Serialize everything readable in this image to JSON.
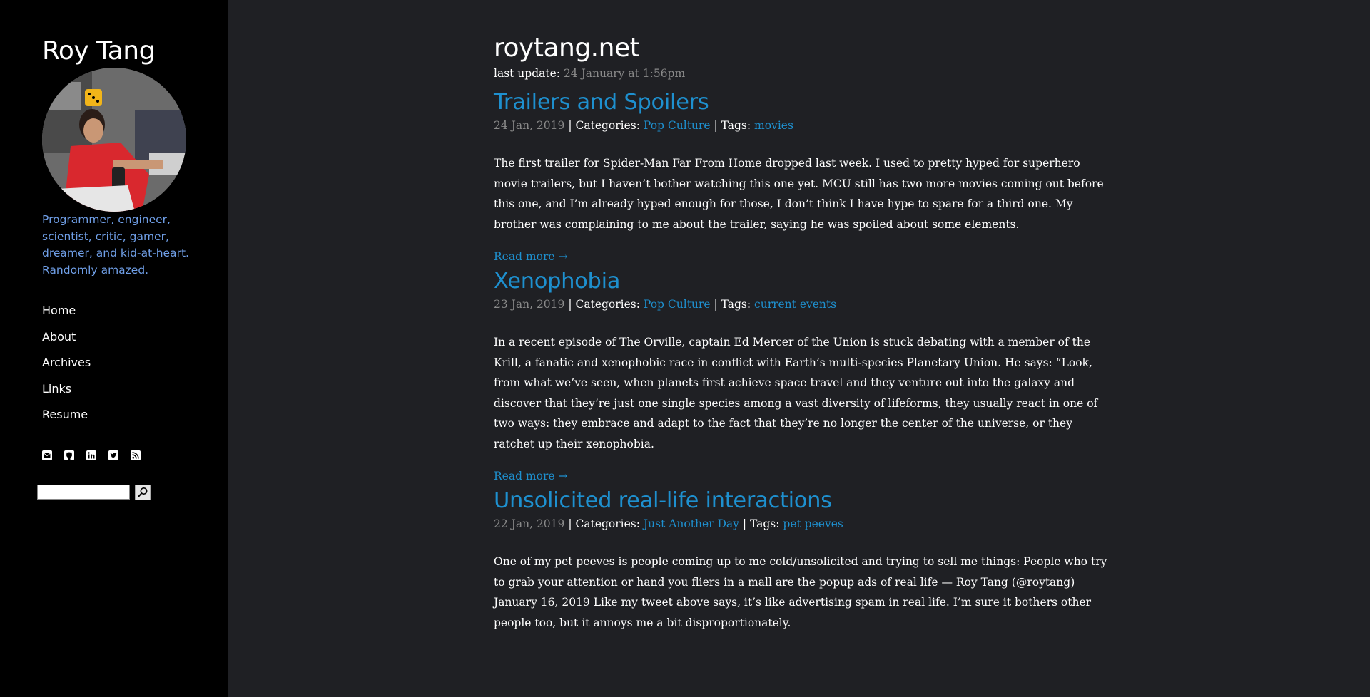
{
  "sidebar": {
    "site_title": "Roy Tang",
    "tagline": "Programmer, engineer, scientist, critic, gamer, dreamer, and kid-at-heart. Randomly amazed.",
    "nav": [
      {
        "label": "Home"
      },
      {
        "label": "About"
      },
      {
        "label": "Archives"
      },
      {
        "label": "Links"
      },
      {
        "label": "Resume"
      }
    ],
    "social_icons": [
      "email-icon",
      "github-icon",
      "linkedin-icon",
      "twitter-icon",
      "rss-icon"
    ],
    "search": {
      "placeholder": "",
      "value": "",
      "button_icon": "search-icon"
    }
  },
  "main": {
    "title": "roytang.net",
    "last_update_label": "last update:",
    "last_update_value": "24 January at 1:56pm",
    "posts": [
      {
        "title": "Trailers and Spoilers",
        "date": "24 Jan, 2019",
        "categories_label": "Categories:",
        "category": "Pop Culture",
        "tags_label": "Tags:",
        "tag": "movies",
        "excerpt": "The first trailer for Spider-Man Far From Home dropped last week. I used to pretty hyped for superhero movie trailers, but I haven’t bother watching this one yet. MCU still has two more movies coming out before this one, and I’m already hyped enough for those, I don’t think I have hype to spare for a third one. My brother was complaining to me about the trailer, saying he was spoiled about some elements.",
        "read_more": "Read more →"
      },
      {
        "title": "Xenophobia",
        "date": "23 Jan, 2019",
        "categories_label": "Categories:",
        "category": "Pop Culture",
        "tags_label": "Tags:",
        "tag": "current events",
        "excerpt": "In a recent episode of The Orville, captain Ed Mercer of the Union is stuck debating with a member of the Krill, a fanatic and xenophobic race in conflict with Earth’s multi-species Planetary Union. He says: “Look, from what we’ve seen, when planets first achieve space travel and they venture out into the galaxy and discover that they’re just one single species among a vast diversity of lifeforms, they usually react in one of two ways: they embrace and adapt to the fact that they’re no longer the center of the universe, or they ratchet up their xenophobia.",
        "read_more": "Read more →"
      },
      {
        "title": "Unsolicited real-life interactions",
        "date": "22 Jan, 2019",
        "categories_label": "Categories:",
        "category": "Just Another Day",
        "tags_label": "Tags:",
        "tag": "pet peeves",
        "excerpt": "One of my pet peeves is people coming up to me cold/unsolicited and trying to sell me things: People who try to grab your attention or hand you fliers in a mall are the popup ads of real life — Roy Tang (@roytang) January 16, 2019 Like my tweet above says, it’s like advertising spam in real life. I’m sure it bothers other people too, but it annoys me a bit disproportionately."
      }
    ]
  },
  "colors": {
    "sidebar_bg": "#000000",
    "main_bg": "#1f2024",
    "link": "#1e90cf",
    "tagline": "#6f9ee6",
    "muted": "#8a8a8a"
  }
}
